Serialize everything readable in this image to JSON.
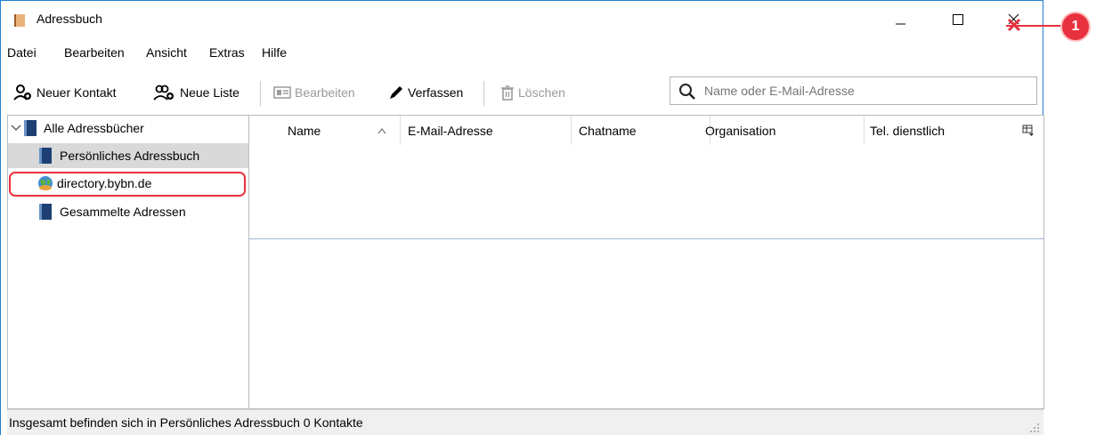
{
  "window": {
    "title": "Adressbuch",
    "icon": "address-book-icon",
    "controls": [
      "minimize-icon",
      "maximize-icon",
      "close-icon"
    ]
  },
  "menu": [
    "Datei",
    "Bearbeiten",
    "Ansicht",
    "Extras",
    "Hilfe"
  ],
  "toolbar": {
    "new_contact": "Neuer Kontakt",
    "new_list": "Neue Liste",
    "edit": "Bearbeiten",
    "compose": "Verfassen",
    "delete": "Löschen"
  },
  "search": {
    "placeholder": "Name oder E-Mail-Adresse"
  },
  "tree": {
    "root": "Alle Adressbücher",
    "items": [
      {
        "label": "Persönliches Adressbuch",
        "icon": "address-book-icon",
        "selected": true
      },
      {
        "label": "directory.bybn.de",
        "icon": "globe-icon",
        "selected": false
      },
      {
        "label": "Gesammelte Adressen",
        "icon": "address-book-icon",
        "selected": false
      }
    ]
  },
  "columns": [
    "Name",
    "E-Mail-Adresse",
    "Chatname",
    "Organisation",
    "Tel. dienstlich"
  ],
  "sort": {
    "column": "Name",
    "direction": "ascending"
  },
  "status": "Insgesamt befinden sich in Persönliches Adressbuch 0 Kontakte",
  "callout": {
    "number": "1"
  },
  "colors": {
    "accent_border": "#1f7fd4",
    "highlight": "#e8313e",
    "selection": "#d9d9d9"
  }
}
